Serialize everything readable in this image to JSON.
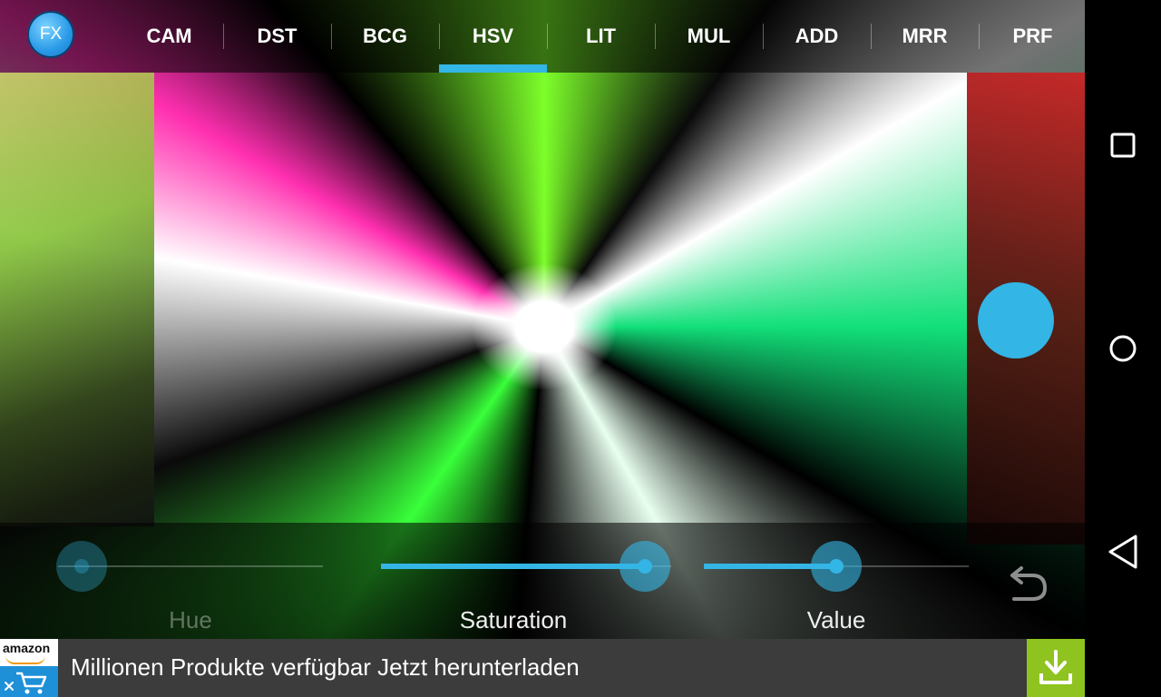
{
  "app": {
    "logo_text": "FX",
    "accent_color": "#33b5e5"
  },
  "tabs": [
    {
      "label": "CAM"
    },
    {
      "label": "DST"
    },
    {
      "label": "BCG"
    },
    {
      "label": "HSV",
      "active": true
    },
    {
      "label": "LIT"
    },
    {
      "label": "MUL"
    },
    {
      "label": "ADD"
    },
    {
      "label": "MRR"
    },
    {
      "label": "PRF"
    }
  ],
  "controls": {
    "sliders": [
      {
        "label": "Hue",
        "value_pct": 0.09,
        "enabled": false
      },
      {
        "label": "Saturation",
        "value_pct": 0.91,
        "enabled": true
      },
      {
        "label": "Value",
        "value_pct": 0.5,
        "enabled": true
      }
    ],
    "undo_icon": "undo-arrow-icon"
  },
  "system_nav": {
    "recents_icon": "square-icon",
    "home_icon": "circle-icon",
    "back_icon": "triangle-back-icon"
  },
  "ad": {
    "brand_text": "amazon",
    "text": "Millionen Produkte verfügbar Jetzt herunterladen",
    "download_icon": "download-icon",
    "download_color": "#8fc31f"
  }
}
